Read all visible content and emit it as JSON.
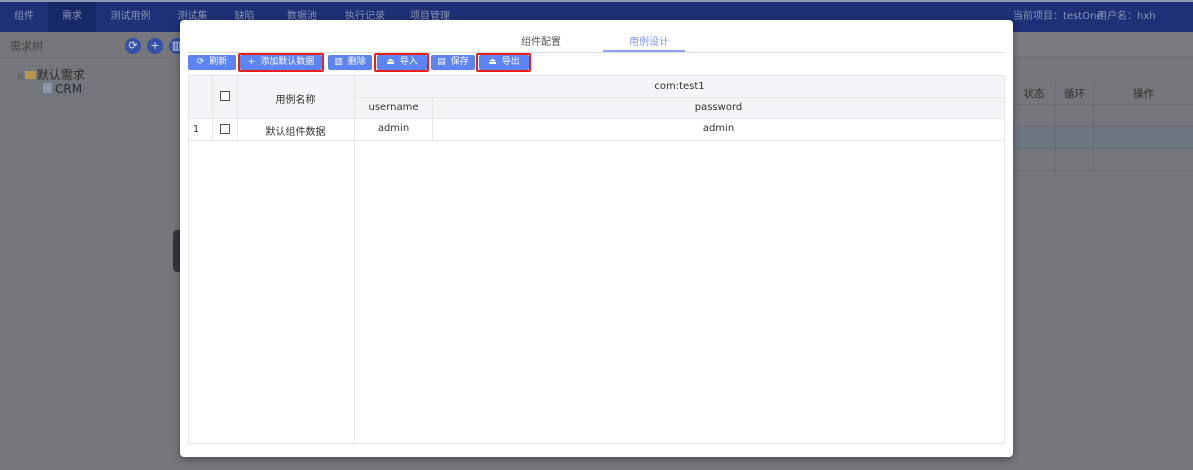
{
  "nav": {
    "items": [
      "组件",
      "需求",
      "测试用例",
      "测试集",
      "缺陷",
      "数据池",
      "执行记录",
      "项目管理"
    ],
    "active": 1,
    "project": "当前项目：testOne",
    "user": "用户名：hxh"
  },
  "sidebar": {
    "title": "需求树",
    "icons": [
      "refresh-icon",
      "plus-icon",
      "delete-icon"
    ],
    "tree": {
      "root": "默认需求",
      "child": "CRM"
    }
  },
  "background_table": {
    "headers": [
      "状态",
      "循环",
      "操作"
    ]
  },
  "modal": {
    "tabs": [
      "组件配置",
      "用例设计"
    ],
    "active_tab": 1,
    "toolbar": {
      "refresh": "刷新",
      "add_default": "添加默认数据",
      "delete": "删除",
      "import": "导入",
      "save": "保存",
      "export": "导出"
    },
    "table": {
      "name_header": "用例名称",
      "group_header": "com:test1",
      "columns": [
        "username",
        "password"
      ],
      "rows": [
        {
          "index": "1",
          "name": "默认组件数据",
          "username": "admin",
          "password": "admin"
        }
      ]
    }
  },
  "colors": {
    "nav": "#1e3177",
    "button": "#5c84f2",
    "highlight": "#e8201c",
    "tab_active": "#7a94f2"
  }
}
